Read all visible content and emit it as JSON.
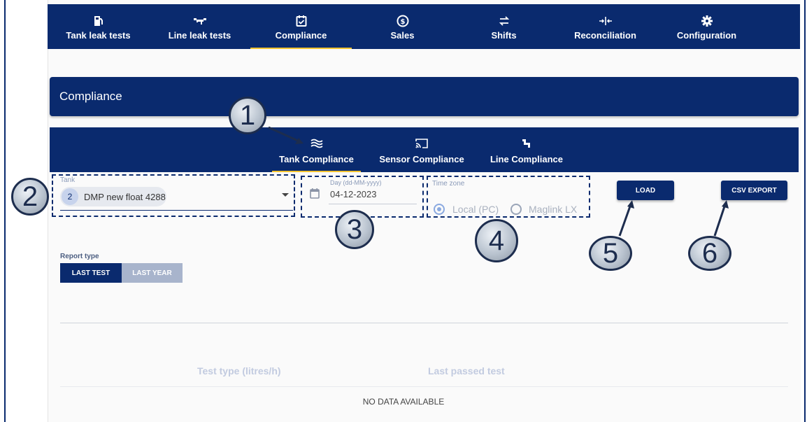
{
  "top_nav": {
    "items": [
      {
        "label": "Tank leak tests",
        "icon": "tank-pump-icon",
        "active": false
      },
      {
        "label": "Line leak tests",
        "icon": "line-pipe-icon",
        "active": false
      },
      {
        "label": "Compliance",
        "icon": "calendar-check-icon",
        "active": true
      },
      {
        "label": "Sales",
        "icon": "dollar-coin-icon",
        "active": false
      },
      {
        "label": "Shifts",
        "icon": "swap-arrows-icon",
        "active": false
      },
      {
        "label": "Reconciliation",
        "icon": "merge-arrows-icon",
        "active": false
      },
      {
        "label": "Configuration",
        "icon": "gear-icon",
        "active": false
      }
    ]
  },
  "page": {
    "title": "Compliance"
  },
  "sub_tabs": {
    "items": [
      {
        "label": "Tank Compliance",
        "icon": "waves-icon",
        "active": true
      },
      {
        "label": "Sensor Compliance",
        "icon": "cast-icon",
        "active": false
      },
      {
        "label": "Line Compliance",
        "icon": "pipe-elbow-icon",
        "active": false
      }
    ]
  },
  "form": {
    "tank": {
      "label": "Tank",
      "chip_number": "2",
      "chip_text": "DMP new float 4288"
    },
    "day": {
      "label": "Day (dd-MM-yyyy)",
      "value": "04-12-2023"
    },
    "timezone": {
      "label": "Time zone",
      "option_local": "Local (PC)",
      "option_maglink": "Maglink LX",
      "selected": "Local (PC)"
    },
    "load_label": "LOAD",
    "csv_export_label": "CSV EXPORT"
  },
  "report_type": {
    "label": "Report type",
    "options": [
      "LAST TEST",
      "LAST YEAR"
    ],
    "selected": "LAST TEST"
  },
  "table": {
    "headers": [
      "Test type (litres/h)",
      "Last passed test"
    ],
    "empty_text": "NO DATA AVAILABLE"
  },
  "callouts": [
    "1",
    "2",
    "3",
    "4",
    "5",
    "6"
  ],
  "colors": {
    "primary": "#0a2a6e",
    "accent": "#f4c430",
    "muted": "#a8b4cc"
  }
}
